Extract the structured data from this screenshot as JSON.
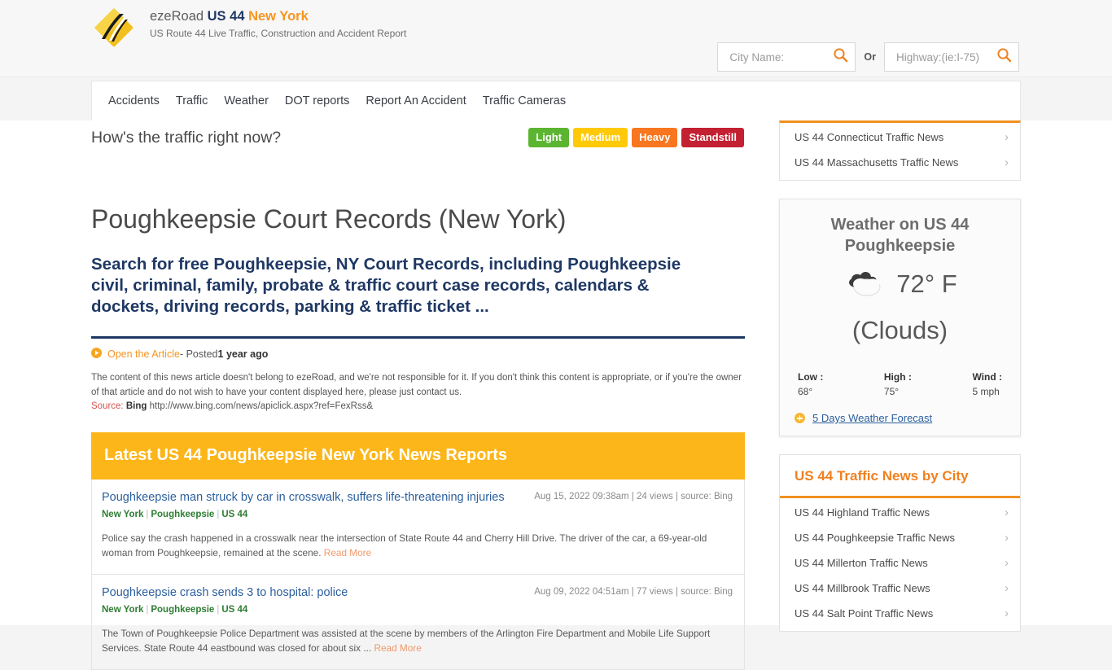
{
  "header": {
    "logo_icon": "ezeroad-diamond-logo",
    "brand_prefix": "ezeRoad ",
    "brand_route": "US 44",
    "brand_state": " New York",
    "tagline": "US Route 44 Live Traffic, Construction and Accident Report",
    "search": {
      "city_placeholder": "City Name:",
      "city_value": "",
      "highway_placeholder": "Highway:(ie:I-75)",
      "highway_value": "",
      "or_label": "Or",
      "search_icon": "magnifier-icon"
    }
  },
  "nav": {
    "items": [
      {
        "label": "Accidents"
      },
      {
        "label": "Traffic"
      },
      {
        "label": "Weather"
      },
      {
        "label": "DOT reports"
      },
      {
        "label": "Report An Accident"
      },
      {
        "label": "Traffic Cameras"
      }
    ]
  },
  "traffic_bar": {
    "question": "How's the traffic right now?",
    "legend": [
      {
        "label": "Light",
        "color": "#5cb531"
      },
      {
        "label": "Medium",
        "color": "#ffc907"
      },
      {
        "label": "Heavy",
        "color": "#f8761f"
      },
      {
        "label": "Standstill",
        "color": "#c32032"
      }
    ]
  },
  "article": {
    "title": "Poughkeepsie Court Records (New York)",
    "subtitle": "Search for free Poughkeepsie, NY Court Records, including Poughkeepsie civil, criminal, family, probate & traffic court case records, calendars & dockets, driving records, parking & traffic ticket ...",
    "open_link": "Open the Article",
    "posted_prefix": " - Posted ",
    "posted_age": "1 year ago",
    "disclaimer": "The content of this news article doesn't belong to ezeRoad, and we're not responsible for it. If you don't think this content is appropriate, or if you're the owner of that article and do not wish to have your content displayed here, please just contact us.",
    "source_label": "Source:",
    "source_name": "Bing",
    "source_url": "http://www.bing.com/news/apiclick.aspx?ref=FexRss&"
  },
  "news": {
    "heading": "Latest US 44 Poughkeepsie New York News Reports",
    "items": [
      {
        "title": "Poughkeepsie man struck by car in crosswalk, suffers life-threatening injuries",
        "meta": "Aug 15, 2022 09:38am | 24 views | source: Bing",
        "tag_state": "New York",
        "tag_city": "Poughkeepsie",
        "tag_route": "US 44",
        "body": "Police say the crash happened in a crosswalk near the intersection of State Route 44 and Cherry Hill Drive. The driver of the car, a 69-year-old woman from Poughkeepsie, remained at the scene. ",
        "read_more": "Read More"
      },
      {
        "title": "Poughkeepsie crash sends 3 to hospital: police",
        "meta": "Aug 09, 2022 04:51am | 77 views | source: Bing",
        "tag_state": "New York",
        "tag_city": "Poughkeepsie",
        "tag_route": "US 44",
        "body": "The Town of Poughkeepsie Police Department was assisted at the scene by members of the Arlington Fire Department and Mobile Life Support Services. State Route 44 eastbound was closed for about six ... ",
        "read_more": "Read More"
      }
    ]
  },
  "sidebar": {
    "state_news": {
      "items": [
        {
          "label": "US 44 Connecticut Traffic News"
        },
        {
          "label": "US 44 Massachusetts Traffic News"
        }
      ]
    },
    "weather": {
      "title": "Weather on US 44 Poughkeepsie",
      "icon": "cloud-icon",
      "temperature": "72° F",
      "condition": "(Clouds)",
      "low_label": "Low :",
      "low_value": "68°",
      "high_label": "High :",
      "high_value": "75°",
      "wind_label": "Wind :",
      "wind_value": "5 mph",
      "forecast_link": "5 Days Weather Forecast",
      "forecast_icon": "plus-circle-icon"
    },
    "city_news": {
      "heading": "US 44 Traffic News by City",
      "items": [
        {
          "label": "US 44 Highland Traffic News"
        },
        {
          "label": "US 44 Poughkeepsie Traffic News"
        },
        {
          "label": "US 44 Millerton Traffic News"
        },
        {
          "label": "US 44 Millbrook Traffic News"
        },
        {
          "label": "US 44 Salt Point Traffic News"
        }
      ]
    },
    "chevron_icon": "chevron-right-icon"
  }
}
